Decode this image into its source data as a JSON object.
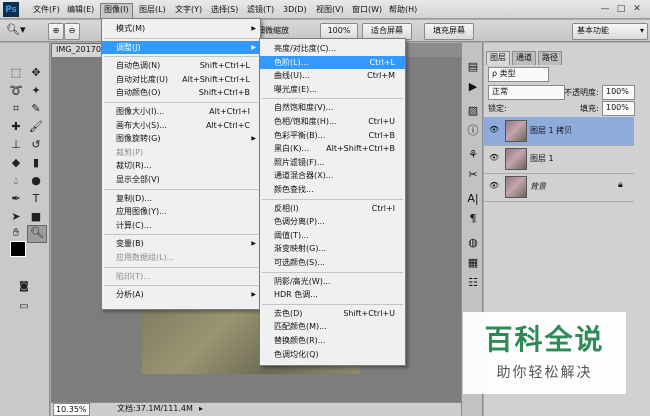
{
  "app": {
    "logo": "Ps"
  },
  "menubar": {
    "items": [
      "文件(F)",
      "编辑(E)",
      "图像(I)",
      "图层(L)",
      "文字(Y)",
      "选择(S)",
      "滤镜(T)",
      "3D(D)",
      "视图(V)",
      "窗口(W)",
      "帮助(H)"
    ],
    "active_index": 2,
    "window_controls": [
      "—",
      "□",
      "✕"
    ]
  },
  "options_bar": {
    "checkbox1_label": "细微缩放",
    "zoom_value": "100%",
    "fit_screen": "适合屏幕",
    "fill_screen": "填充屏幕",
    "workspace": "基本功能"
  },
  "document": {
    "tab_title": "IMG_20170...",
    "zoom": "10.35%",
    "doc_info": "文档:37.1M/111.4M"
  },
  "image_menu": {
    "items": [
      {
        "label": "模式(M)",
        "sub": true
      },
      {
        "sep": true
      },
      {
        "label": "调整(J)",
        "sub": true,
        "hl": true
      },
      {
        "sep": true
      },
      {
        "label": "自动色调(N)",
        "shortcut": "Shift+Ctrl+L"
      },
      {
        "label": "自动对比度(U)",
        "shortcut": "Alt+Shift+Ctrl+L"
      },
      {
        "label": "自动颜色(O)",
        "shortcut": "Shift+Ctrl+B"
      },
      {
        "sep": true
      },
      {
        "label": "图像大小(I)...",
        "shortcut": "Alt+Ctrl+I"
      },
      {
        "label": "画布大小(S)...",
        "shortcut": "Alt+Ctrl+C"
      },
      {
        "label": "图像旋转(G)",
        "sub": true
      },
      {
        "label": "裁剪(P)",
        "disabled": true
      },
      {
        "label": "裁切(R)..."
      },
      {
        "label": "显示全部(V)"
      },
      {
        "sep": true
      },
      {
        "label": "复制(D)..."
      },
      {
        "label": "应用图像(Y)..."
      },
      {
        "label": "计算(C)..."
      },
      {
        "sep": true
      },
      {
        "label": "变量(B)",
        "sub": true
      },
      {
        "label": "应用数据组(L)...",
        "disabled": true
      },
      {
        "sep": true
      },
      {
        "label": "陷印(T)...",
        "disabled": true
      },
      {
        "sep": true
      },
      {
        "label": "分析(A)",
        "sub": true
      }
    ]
  },
  "adjust_menu": {
    "items": [
      {
        "label": "亮度/对比度(C)..."
      },
      {
        "label": "色阶(L)...",
        "shortcut": "Ctrl+L",
        "hl": true
      },
      {
        "label": "曲线(U)...",
        "shortcut": "Ctrl+M"
      },
      {
        "label": "曝光度(E)..."
      },
      {
        "sep": true
      },
      {
        "label": "自然饱和度(V)..."
      },
      {
        "label": "色相/饱和度(H)...",
        "shortcut": "Ctrl+U"
      },
      {
        "label": "色彩平衡(B)...",
        "shortcut": "Ctrl+B"
      },
      {
        "label": "黑白(K)...",
        "shortcut": "Alt+Shift+Ctrl+B"
      },
      {
        "label": "照片滤镜(F)..."
      },
      {
        "label": "通道混合器(X)..."
      },
      {
        "label": "颜色查找..."
      },
      {
        "sep": true
      },
      {
        "label": "反相(I)",
        "shortcut": "Ctrl+I"
      },
      {
        "label": "色调分离(P)..."
      },
      {
        "label": "阈值(T)..."
      },
      {
        "label": "渐变映射(G)..."
      },
      {
        "label": "可选颜色(S)..."
      },
      {
        "sep": true
      },
      {
        "label": "阴影/高光(W)..."
      },
      {
        "label": "HDR 色调..."
      },
      {
        "sep": true
      },
      {
        "label": "去色(D)",
        "shortcut": "Shift+Ctrl+U"
      },
      {
        "label": "匹配颜色(M)..."
      },
      {
        "label": "替换颜色(R)..."
      },
      {
        "label": "色调均化(Q)"
      }
    ]
  },
  "layers_panel": {
    "tabs": [
      "图层",
      "通道",
      "路径"
    ],
    "filter_label": "ρ 类型",
    "blend_mode": "正常",
    "opacity_label": "不透明度:",
    "opacity": "100%",
    "lock_label": "锁定:",
    "fill_label": "填充:",
    "fill": "100%",
    "layers": [
      {
        "name": "图层 1 拷贝",
        "selected": true
      },
      {
        "name": "图层 1"
      },
      {
        "name": "背景",
        "locked": true
      }
    ]
  },
  "watermark": {
    "title": "百科全说",
    "subtitle": "助你轻松解决"
  },
  "colors": {
    "menu_highlight": "#3399ff",
    "layer_selected": "#8eabdb",
    "ps_logo": "#0c2f4c"
  }
}
